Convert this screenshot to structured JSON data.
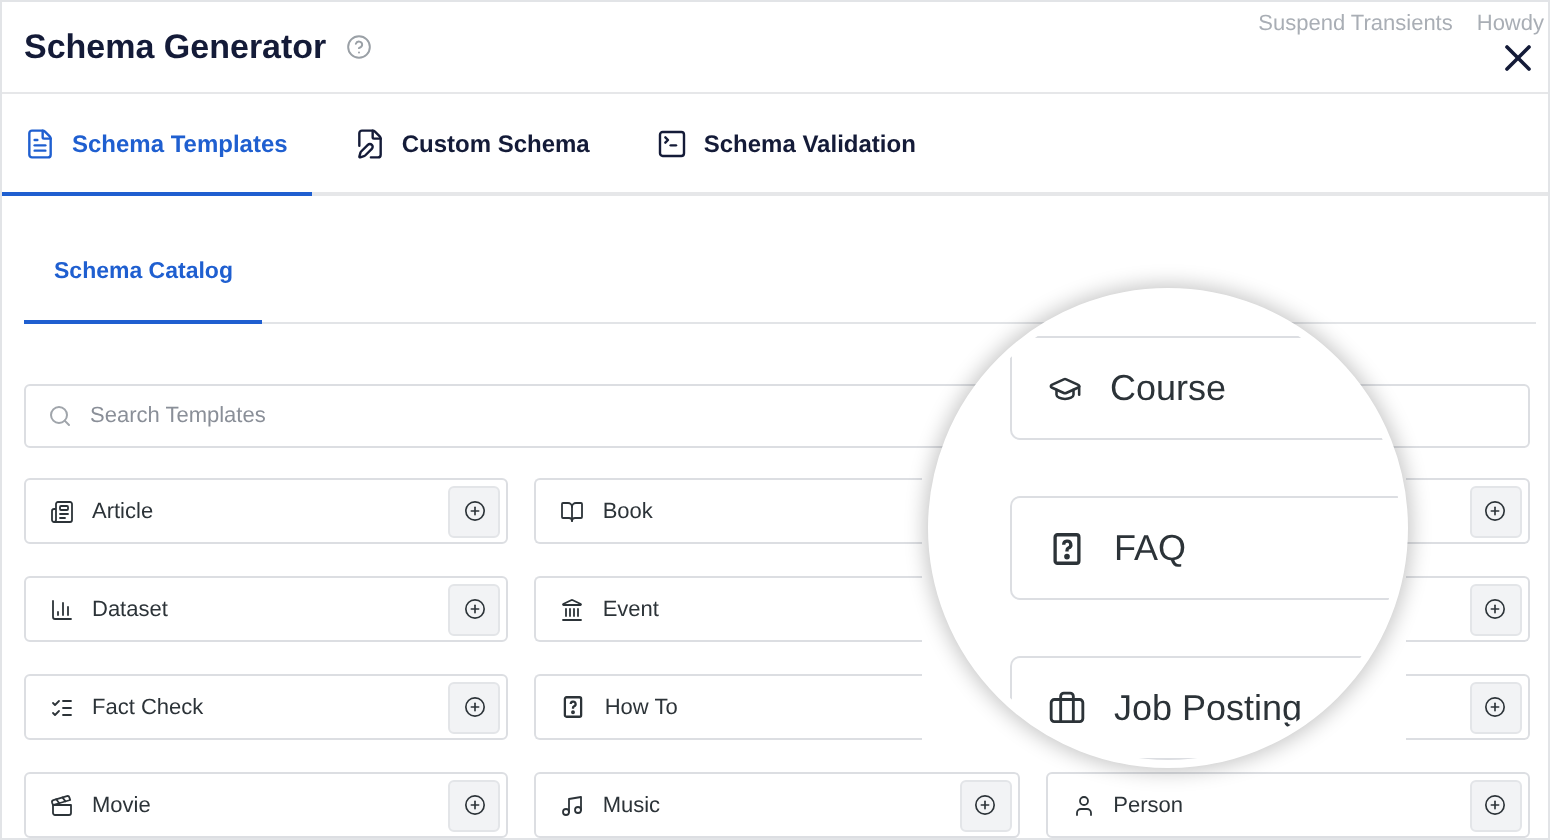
{
  "background_text": [
    "Suspend Transients",
    "Howdy"
  ],
  "header": {
    "title": "Schema Generator"
  },
  "tabs": [
    {
      "label": "Schema Templates",
      "selected": true
    },
    {
      "label": "Custom Schema",
      "selected": false
    },
    {
      "label": "Schema Validation",
      "selected": false
    }
  ],
  "subtabs": [
    {
      "label": "Schema Catalog",
      "selected": true
    }
  ],
  "search": {
    "placeholder": "Search Templates"
  },
  "templates": [
    {
      "label": "Article",
      "add_button": true
    },
    {
      "label": "Book",
      "add_button": false
    },
    {
      "add_button": true
    },
    {
      "label": "Dataset",
      "add_button": true
    },
    {
      "label": "Event",
      "add_button": false
    },
    {
      "add_button": true
    },
    {
      "label": "Fact Check",
      "add_button": true
    },
    {
      "label": "How To",
      "add_button": false
    },
    {
      "add_button": true
    },
    {
      "label": "Movie",
      "add_button": true
    },
    {
      "label": "Music",
      "add_button": true
    },
    {
      "label": "Person",
      "add_button": true
    }
  ],
  "magnifier": {
    "items": [
      {
        "label": "Course"
      },
      {
        "label": "FAQ"
      },
      {
        "label": "Job Posting"
      }
    ]
  }
}
